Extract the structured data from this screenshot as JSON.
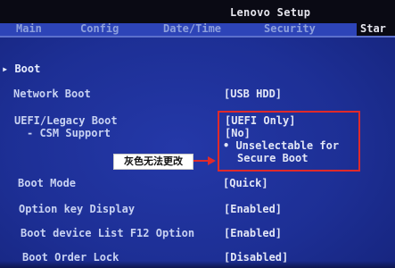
{
  "bios": {
    "title": "Lenovo Setup"
  },
  "menu": {
    "tabs": [
      {
        "label": "Main"
      },
      {
        "label": "Config"
      },
      {
        "label": "Date/Time"
      },
      {
        "label": "Security"
      },
      {
        "label": "Star"
      }
    ],
    "active_tab_index": 4
  },
  "section": {
    "title": "Boot"
  },
  "settings": {
    "network_boot": {
      "label": "Network Boot",
      "value": "[USB HDD]"
    },
    "uefi_legacy": {
      "label": "UEFI/Legacy Boot",
      "sublabel": "- CSM Support",
      "value": "[UEFI Only]",
      "value2": "[No]",
      "note_line1": "• Unselectable for",
      "note_line2": "Secure Boot"
    },
    "boot_mode": {
      "label": "Boot Mode",
      "value": "[Quick]"
    },
    "option_key_display": {
      "label": "Option key Display",
      "value": "[Enabled]"
    },
    "boot_device_list": {
      "label": "Boot device List F12 Option",
      "value": "[Enabled]"
    },
    "boot_order_lock": {
      "label": "Boot Order Lock",
      "value": "[Disabled]"
    }
  },
  "annotation": {
    "callout_text": "灰色无法更改",
    "highlight_color": "#e02a2a"
  },
  "colors": {
    "background": "#1b2a8c",
    "title_bar": "#0a0a14",
    "text": "#e2e6f6"
  }
}
